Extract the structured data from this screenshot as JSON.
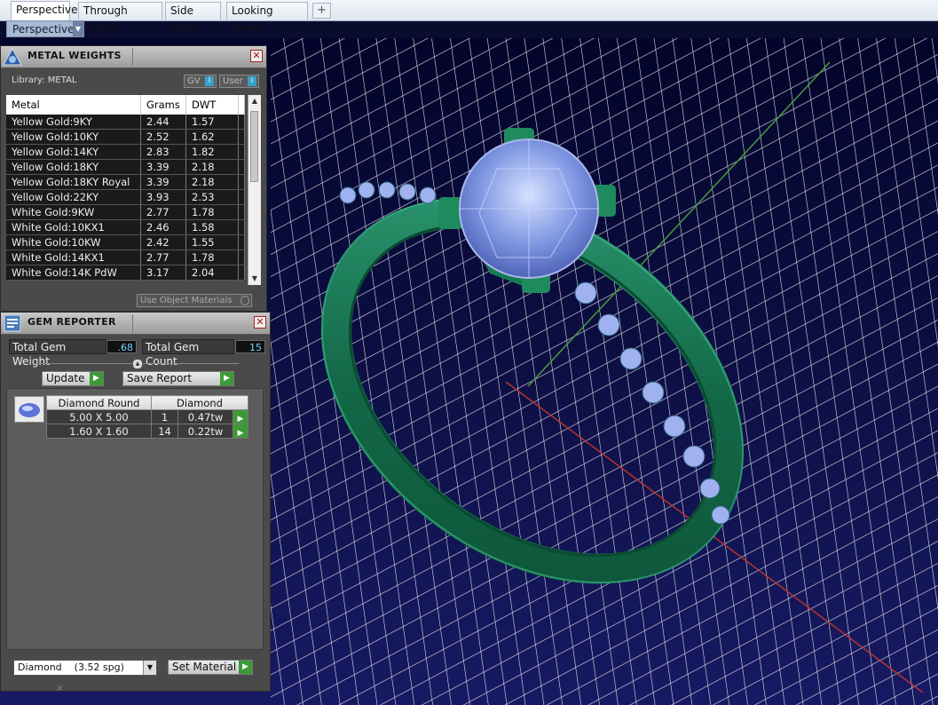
{
  "tabs": [
    "Perspective",
    "Through Finger",
    "Side View",
    "Looking Down"
  ],
  "add_tab_glyph": "+",
  "viewport_label": "Perspective",
  "metal_weights": {
    "title": "METAL WEIGHTS",
    "library_label": "Library: METAL",
    "gv_label": "GV",
    "user_label": "User",
    "columns": [
      "Metal",
      "Grams",
      "DWT"
    ],
    "rows": [
      [
        "Yellow Gold:9KY",
        "2.44",
        "1.57"
      ],
      [
        "Yellow Gold:10KY",
        "2.52",
        "1.62"
      ],
      [
        "Yellow Gold:14KY",
        "2.83",
        "1.82"
      ],
      [
        "Yellow Gold:18KY",
        "3.39",
        "2.18"
      ],
      [
        "Yellow Gold:18KY Royal",
        "3.39",
        "2.18"
      ],
      [
        "Yellow Gold:22KY",
        "3.93",
        "2.53"
      ],
      [
        "White Gold:9KW",
        "2.77",
        "1.78"
      ],
      [
        "White Gold:10KX1",
        "2.46",
        "1.58"
      ],
      [
        "White Gold:10KW",
        "2.42",
        "1.55"
      ],
      [
        "White Gold:14KX1",
        "2.77",
        "1.78"
      ],
      [
        "White Gold:14K PdW",
        "3.17",
        "2.04"
      ]
    ],
    "use_object_materials": "Use Object Materials"
  },
  "gem_reporter": {
    "title": "GEM REPORTER",
    "total_weight_label": "Total Gem Weight",
    "total_weight_value": ".68",
    "total_count_label": "Total Gem Count",
    "total_count_value": "15",
    "update_label": "Update",
    "save_report_label": "Save Report",
    "table_headers": [
      "Diamond Round",
      "Diamond"
    ],
    "rows": [
      {
        "size": "5.00 X 5.00",
        "count": "1",
        "weight": "0.47tw"
      },
      {
        "size": "1.60 X 1.60",
        "count": "14",
        "weight": "0.22tw"
      }
    ],
    "material_select": "Diamond    (3.52 spg)",
    "set_material_label": "Set Material",
    "x_glyph": "×"
  },
  "icons": [
    "metal-weights-icon",
    "gem-reporter-icon",
    "close-icon",
    "dropdown-arrow-icon",
    "go-arrow-icon",
    "gem-thumbnail-icon"
  ],
  "colors": {
    "viewport_bg": "#0b0d3f",
    "ring_green": "#1f7a5a",
    "gem_blue": "#8aa4ea",
    "grid": "#e8e8e8",
    "accent_green": "#3b9a36"
  }
}
